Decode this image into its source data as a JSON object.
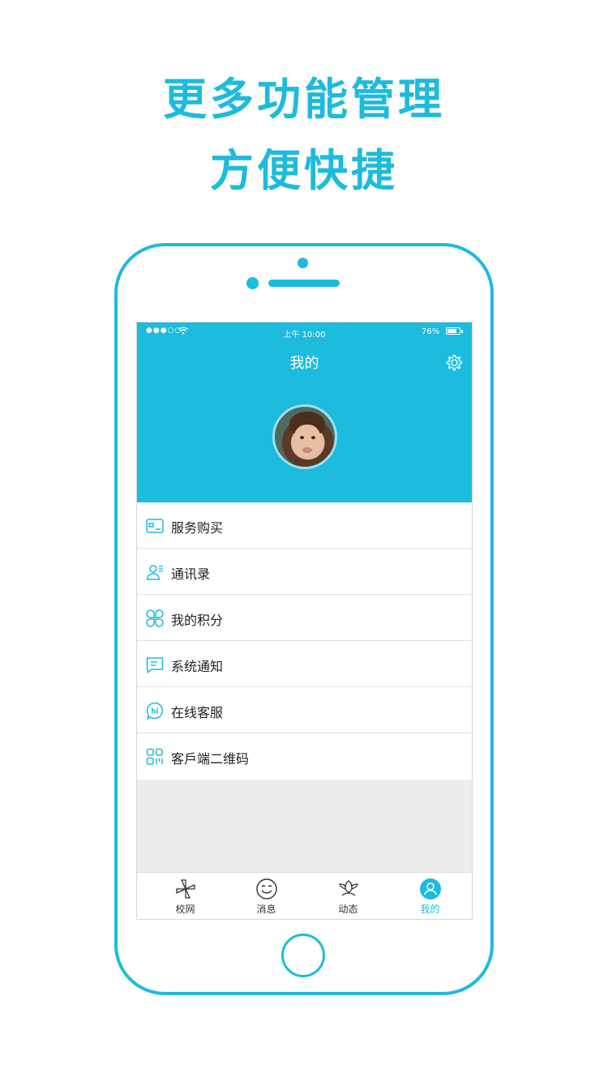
{
  "promo": {
    "line1": "更多功能管理",
    "line2": "方便快捷"
  },
  "status_bar": {
    "signal": "●●●○○",
    "time": "上午  10:00",
    "battery": "76%",
    "battery_level": 0.76
  },
  "header": {
    "title": "我的"
  },
  "menu": [
    {
      "label": "服务购买",
      "icon": "card-icon"
    },
    {
      "label": "通讯录",
      "icon": "contacts-icon"
    },
    {
      "label": "我的积分",
      "icon": "points-icon"
    },
    {
      "label": "系统通知",
      "icon": "message-icon"
    },
    {
      "label": "在线客服",
      "icon": "hi-chat-icon"
    },
    {
      "label": "客戶端二维码",
      "icon": "qr-code-icon"
    }
  ],
  "tabs": [
    {
      "label": "校网",
      "icon": "pinwheel-icon"
    },
    {
      "label": "消息",
      "icon": "smile-icon"
    },
    {
      "label": "动态",
      "icon": "flower-icon"
    },
    {
      "label": "我的",
      "icon": "user-icon",
      "active": true
    }
  ],
  "colors": {
    "accent": "#1dbbdd",
    "background": "#ededed"
  }
}
